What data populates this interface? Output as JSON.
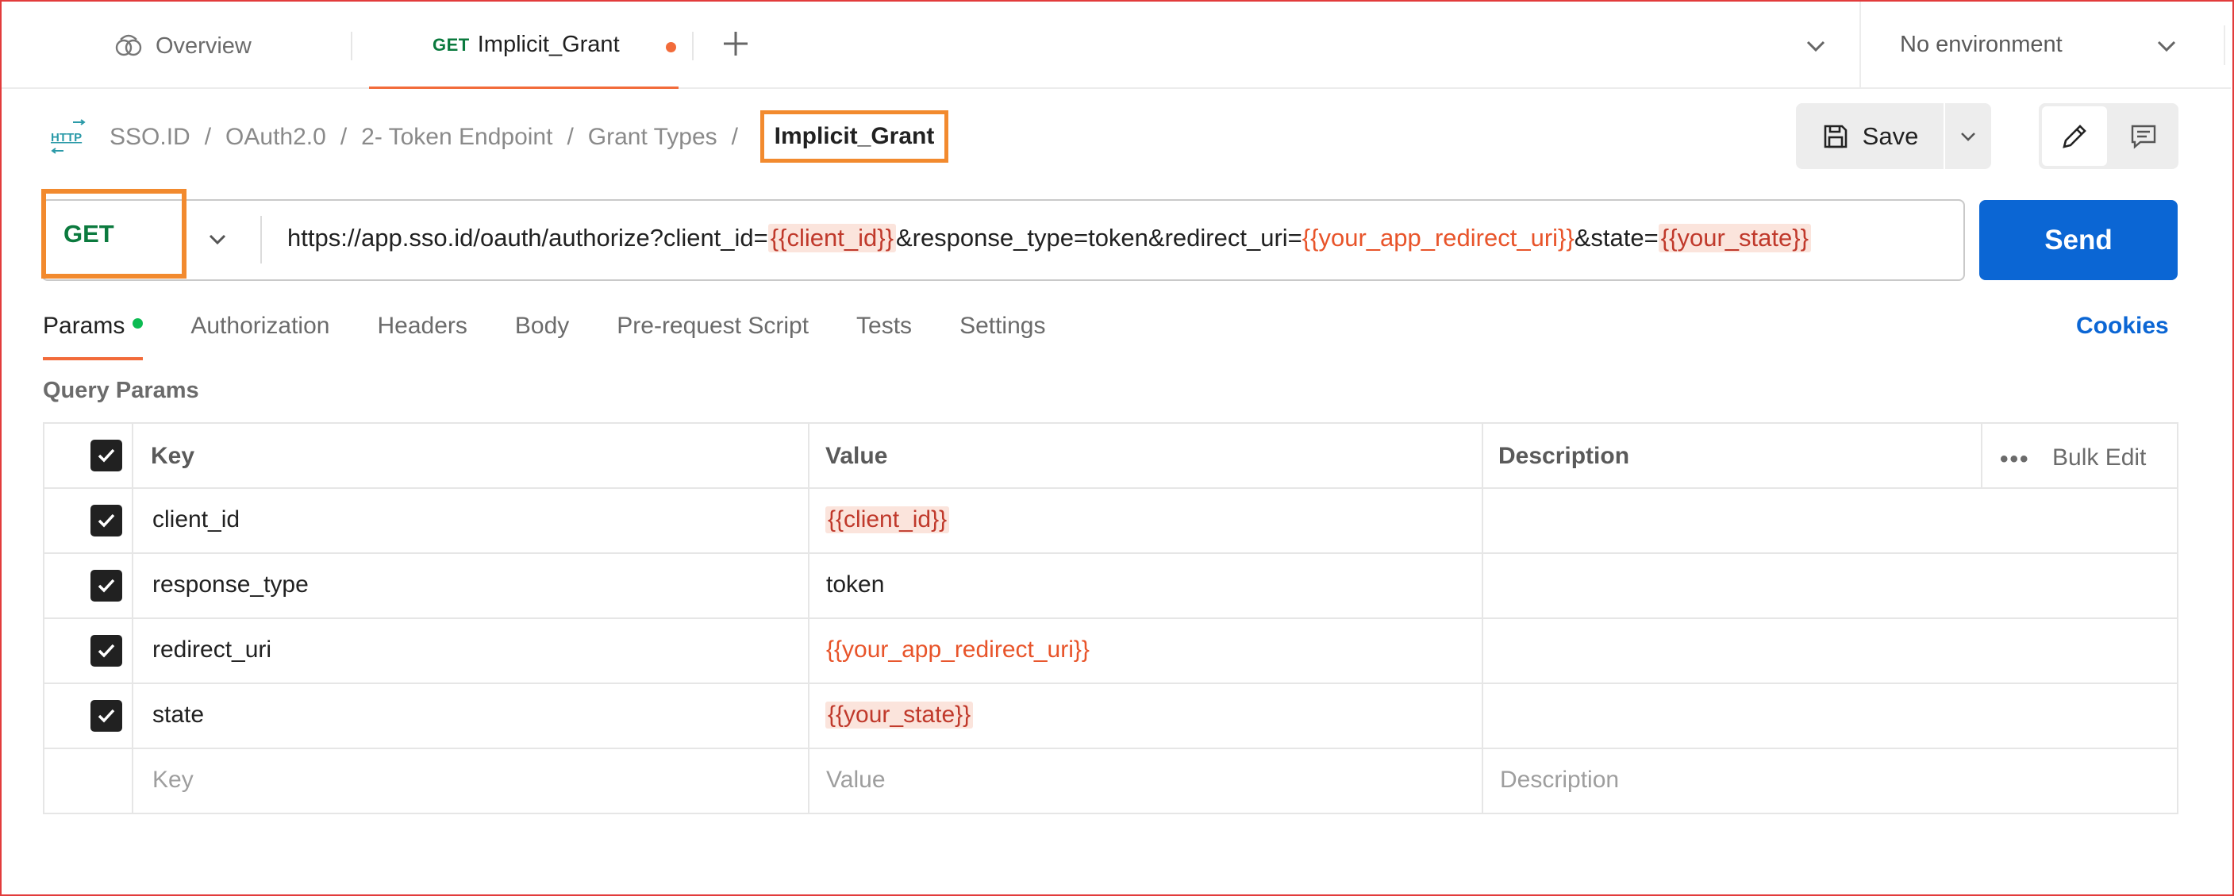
{
  "tabs": {
    "overview_label": "Overview",
    "active_method": "GET",
    "active_title": "Implicit_Grant",
    "environment": "No environment"
  },
  "breadcrumb": {
    "items": [
      "SSO.ID",
      "OAuth2.0",
      "2- Token Endpoint",
      "Grant Types"
    ],
    "current": "Implicit_Grant"
  },
  "toolbar": {
    "save_label": "Save"
  },
  "request": {
    "method": "GET",
    "url_parts": [
      {
        "text": "https://app.sso.id/oauth/authorize?client_id=",
        "type": "text"
      },
      {
        "text": "{{client_id}}",
        "type": "var-hl"
      },
      {
        "text": "&response_type=token&redirect_uri=",
        "type": "text"
      },
      {
        "text": "{{your_app_redirect_uri}}",
        "type": "var"
      },
      {
        "text": "&state=",
        "type": "text"
      },
      {
        "text": "{{your_state}}",
        "type": "var-hl"
      }
    ],
    "send_label": "Send"
  },
  "request_tabs": [
    "Params",
    "Authorization",
    "Headers",
    "Body",
    "Pre-request Script",
    "Tests",
    "Settings"
  ],
  "cookies_label": "Cookies",
  "query_params": {
    "title": "Query Params",
    "headers": {
      "key": "Key",
      "value": "Value",
      "description": "Description",
      "bulk_edit": "Bulk Edit"
    },
    "rows": [
      {
        "key": "client_id",
        "value": "{{client_id}}",
        "value_type": "var-hl"
      },
      {
        "key": "response_type",
        "value": "token",
        "value_type": "text"
      },
      {
        "key": "redirect_uri",
        "value": "{{your_app_redirect_uri}}",
        "value_type": "var"
      },
      {
        "key": "state",
        "value": "{{your_state}}",
        "value_type": "var-hl"
      }
    ],
    "placeholders": {
      "key": "Key",
      "value": "Value",
      "description": "Description"
    }
  },
  "colors": {
    "accent": "#f26b3a",
    "highlight_box": "#f28a2e",
    "method_green": "#0b7a3e",
    "send_blue": "#0b66d4",
    "variable": "#e8542a"
  }
}
